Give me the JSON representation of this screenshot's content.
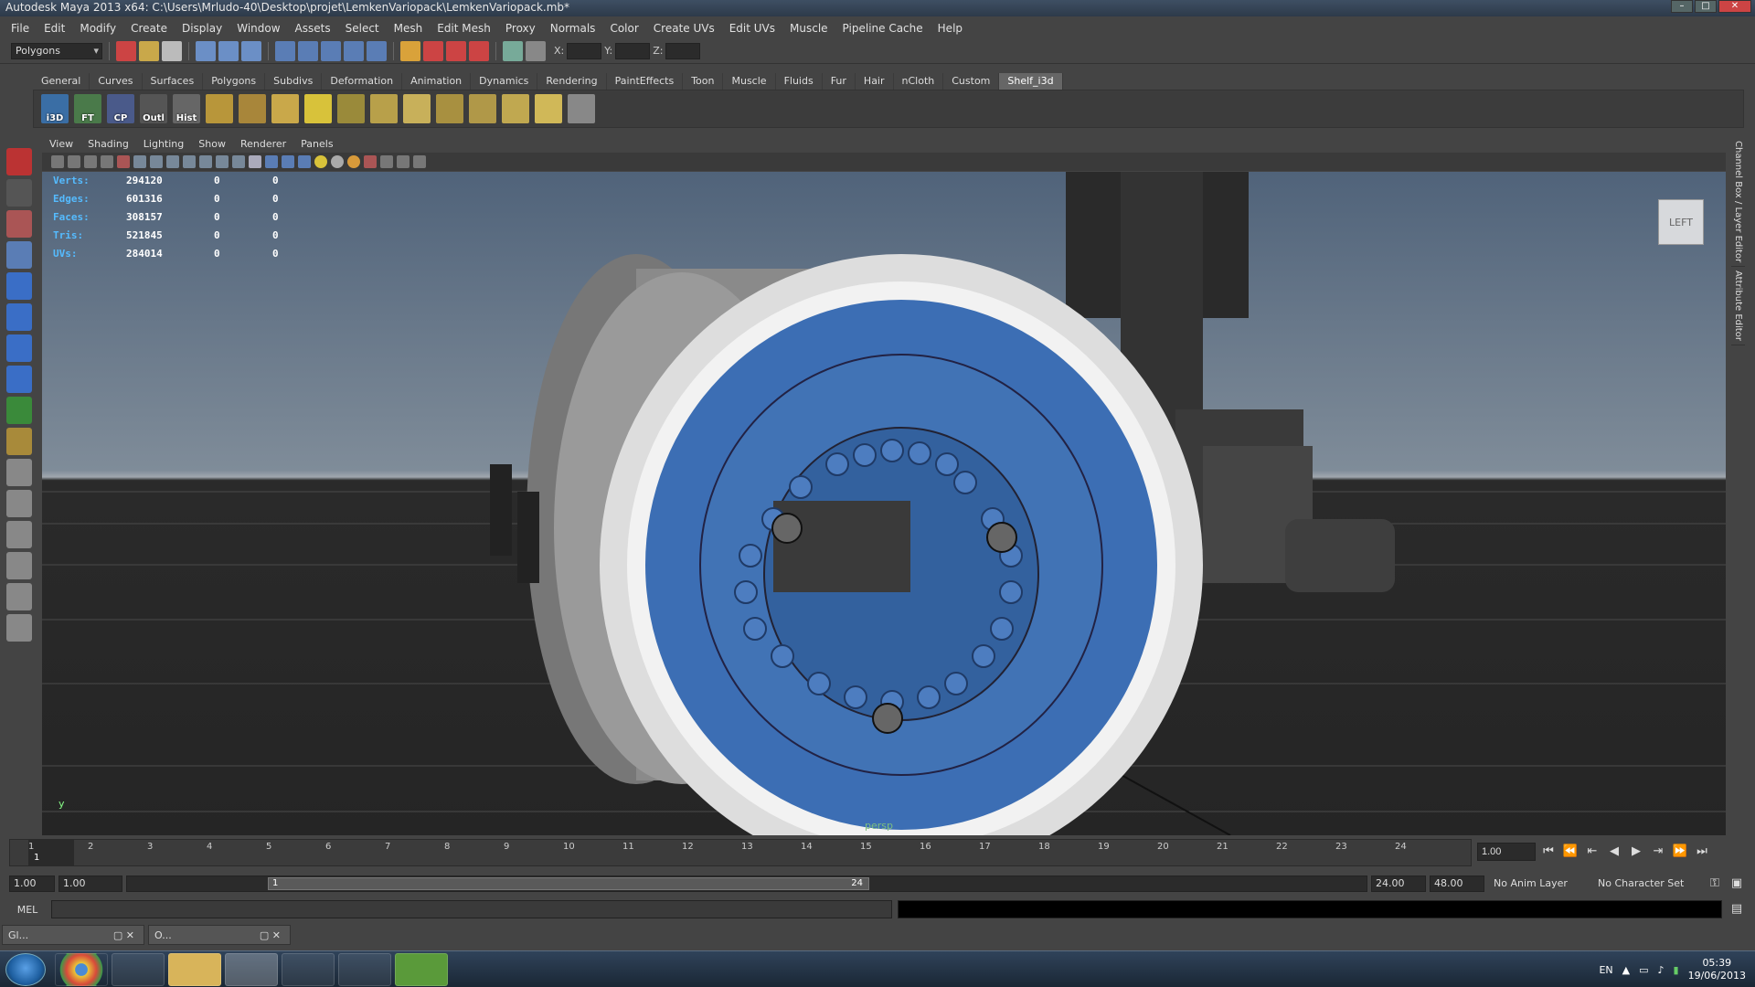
{
  "window": {
    "title": "Autodesk Maya 2013 x64: C:\\Users\\Mrludo-40\\Desktop\\projet\\LemkenVariopack\\LemkenVariopack.mb*"
  },
  "menu": [
    "File",
    "Edit",
    "Modify",
    "Create",
    "Display",
    "Window",
    "Assets",
    "Select",
    "Mesh",
    "Edit Mesh",
    "Proxy",
    "Normals",
    "Color",
    "Create UVs",
    "Edit UVs",
    "Muscle",
    "Pipeline Cache",
    "Help"
  ],
  "status": {
    "mode": "Polygons",
    "x_label": "X:",
    "y_label": "Y:",
    "z_label": "Z:"
  },
  "shelf_tabs": [
    "General",
    "Curves",
    "Surfaces",
    "Polygons",
    "Subdivs",
    "Deformation",
    "Animation",
    "Dynamics",
    "Rendering",
    "PaintEffects",
    "Toon",
    "Muscle",
    "Fluids",
    "Fur",
    "Hair",
    "nCloth",
    "Custom",
    "Shelf_i3d"
  ],
  "shelf_active": "Shelf_i3d",
  "shelf_icons": [
    {
      "label": "i3D",
      "color": "#3a6ea5"
    },
    {
      "label": "FT",
      "color": "#4a7a4a"
    },
    {
      "label": "CP",
      "color": "#4a5a8a"
    },
    {
      "label": "Outl",
      "color": "#555"
    },
    {
      "label": "Hist",
      "color": "#666"
    }
  ],
  "panel_menu": [
    "View",
    "Shading",
    "Lighting",
    "Show",
    "Renderer",
    "Panels"
  ],
  "hud": {
    "rows": [
      {
        "k": "Verts:",
        "v": "294120",
        "a": "0",
        "b": "0"
      },
      {
        "k": "Edges:",
        "v": "601316",
        "a": "0",
        "b": "0"
      },
      {
        "k": "Faces:",
        "v": "308157",
        "a": "0",
        "b": "0"
      },
      {
        "k": "Tris:",
        "v": "521845",
        "a": "0",
        "b": "0"
      },
      {
        "k": "UVs:",
        "v": "284014",
        "a": "0",
        "b": "0"
      }
    ]
  },
  "viewcube": "LEFT",
  "camera": "persp",
  "axis_label": "y",
  "right_dock": [
    "Channel Box / Layer Editor",
    "Attribute Editor"
  ],
  "timeline": {
    "ticks": [
      "1",
      "2",
      "3",
      "4",
      "5",
      "6",
      "7",
      "8",
      "9",
      "10",
      "11",
      "12",
      "13",
      "14",
      "15",
      "16",
      "17",
      "18",
      "19",
      "20",
      "21",
      "22",
      "23",
      "24"
    ],
    "current": "1",
    "current_field": "1.00"
  },
  "range": {
    "start": "1.00",
    "playstart": "1.00",
    "slider_start": "1",
    "slider_end": "24",
    "playend": "24.00",
    "end": "48.00",
    "anim_layer": "No Anim Layer",
    "char_set": "No Character Set"
  },
  "cmdline": {
    "label": "MEL"
  },
  "min_windows": [
    {
      "title": "Gl..."
    },
    {
      "title": "O..."
    }
  ],
  "tray": {
    "lang": "EN",
    "time": "05:39",
    "date": "19/06/2013"
  }
}
